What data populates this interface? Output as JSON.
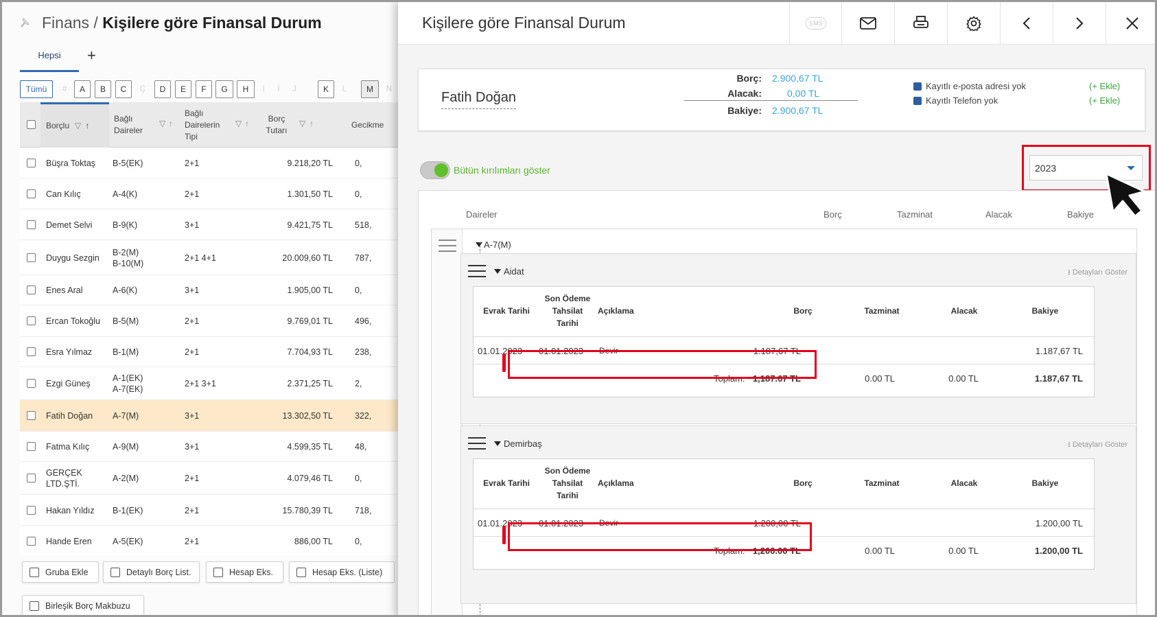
{
  "header": {
    "module": "Finans",
    "separator": " / ",
    "title": "Kişilere göre Finansal Durum"
  },
  "tabs": {
    "active": "Hepsi",
    "add": "+"
  },
  "letters": [
    "Tümü",
    "#",
    "A",
    "B",
    "C",
    "Ç",
    "D",
    "E",
    "F",
    "G",
    "H",
    "I",
    "İ",
    "J",
    "K",
    "L",
    "M",
    "N"
  ],
  "grid": {
    "columns": {
      "borclu": "Borçlu",
      "daireler": "Bağlı Daireler",
      "tipi": "Bağlı Dairelerin Tipi",
      "borc": "Borç Tutarı",
      "gecikme": "Gecikme"
    },
    "rows": [
      {
        "name": "Büşra Toktaş",
        "units": "B-5(EK)",
        "type": "2+1",
        "amount": "9.218,20 TL",
        "late": "0,"
      },
      {
        "name": "Can Kılıç",
        "units": "A-4(K)",
        "type": "2+1",
        "amount": "1.301,50 TL",
        "late": "0,"
      },
      {
        "name": "Demet Selvi",
        "units": "B-9(K)",
        "type": "3+1",
        "amount": "9.421,75 TL",
        "late": "518,"
      },
      {
        "name": "Duygu Sezgin",
        "units": "B-2(M)\nB-10(M)",
        "type": "2+1 4+1",
        "amount": "20.009,60 TL",
        "late": "787,"
      },
      {
        "name": "Enes Aral",
        "units": "A-6(K)",
        "type": "3+1",
        "amount": "1.905,00 TL",
        "late": "0,"
      },
      {
        "name": "Ercan Tokoğlu",
        "units": "B-5(M)",
        "type": "2+1",
        "amount": "9.769,01 TL",
        "late": "496,"
      },
      {
        "name": "Esra Yılmaz",
        "units": "B-1(M)",
        "type": "2+1",
        "amount": "7.704,93 TL",
        "late": "238,"
      },
      {
        "name": "Ezgi Güneş",
        "units": "A-1(EK)\nA-7(EK)",
        "type": "2+1 3+1",
        "amount": "2.371,25 TL",
        "late": "2,"
      },
      {
        "name": "Fatih Doğan",
        "units": "A-7(M)",
        "type": "3+1",
        "amount": "13.302,50 TL",
        "late": "322,"
      },
      {
        "name": "Fatma Kılıç",
        "units": "A-9(M)",
        "type": "3+1",
        "amount": "4.599,35 TL",
        "late": "48,"
      },
      {
        "name": "GERÇEK\nLTD.ŞTİ.",
        "units": "A-2(M)",
        "type": "2+1",
        "amount": "4.079,46 TL",
        "late": "0,"
      },
      {
        "name": "Hakan Yıldız",
        "units": "B-1(EK)",
        "type": "2+1",
        "amount": "15.780,39 TL",
        "late": "718,"
      },
      {
        "name": "Hande Eren",
        "units": "A-5(EK)",
        "type": "2+1",
        "amount": "886,00 TL",
        "late": "0,"
      }
    ]
  },
  "buttons": {
    "group_add": "Gruba Ekle",
    "detail_list": "Detaylı Borç List.",
    "account_ex": "Hesap Eks.",
    "account_ex_list": "Hesap Eks. (Liste)",
    "combined": "Birleşik Borç Makbuzu"
  },
  "panel": {
    "title": "Kişilere göre Finansal Durum",
    "sms": "SMS",
    "person": "Fatih Doğan",
    "borc_label": "Borç:",
    "borc": "2.900,67 TL",
    "alacak_label": "Alacak:",
    "alacak": "0,00 TL",
    "bakiye_label": "Bakiye:",
    "bakiye": "2.900,67 TL",
    "email_info": "Kayıtlı e-posta adresi yok",
    "phone_info": "Kayıtlı Telefon yok",
    "add": "(+ Ekle)",
    "toggle_label": "Bütün kırılımları göster",
    "year": "2023",
    "cols": {
      "daireler": "Daireler",
      "borc": "Borç",
      "tazminat": "Tazminat",
      "alacak": "Alacak",
      "bakiye": "Bakiye"
    },
    "apartment": "A-7(M)",
    "detail_btn": "Detayları Göster",
    "th": {
      "evrak": "Evrak Tarihi",
      "son": "Son Ödeme\nTahsilat\nTarihi",
      "aciklama": "Açıklama",
      "borc": "Borç",
      "tazminat": "Tazminat",
      "alacak": "Alacak",
      "bakiye": "Bakiye"
    },
    "total_label": "Toplam:",
    "sections": [
      {
        "name": "Aidat",
        "evrak": "01.01.2023",
        "son": "01.01.2023",
        "aciklama": "Devir",
        "borc": "1.187,67 TL",
        "bakiye": "1.187,67 TL",
        "t_borc": "1,187.67 TL",
        "t_tazminat": "0.00 TL",
        "t_alacak": "0.00 TL",
        "t_bakiye": "1.187,67 TL"
      },
      {
        "name": "Demirbaş",
        "evrak": "01.01.2023",
        "son": "01.01.2023",
        "aciklama": "Devir",
        "borc": "1.200,00 TL",
        "bakiye": "1.200,00 TL",
        "t_borc": "1,200.00 TL",
        "t_tazminat": "0.00 TL",
        "t_alacak": "0.00 TL",
        "t_bakiye": "1.200,00 TL"
      }
    ]
  },
  "colors": {
    "accent": "#2f6bb0",
    "value": "#38a6d9",
    "green": "#59b52b",
    "highlight": "#e3001b",
    "selected_row": "#fde9c9"
  }
}
